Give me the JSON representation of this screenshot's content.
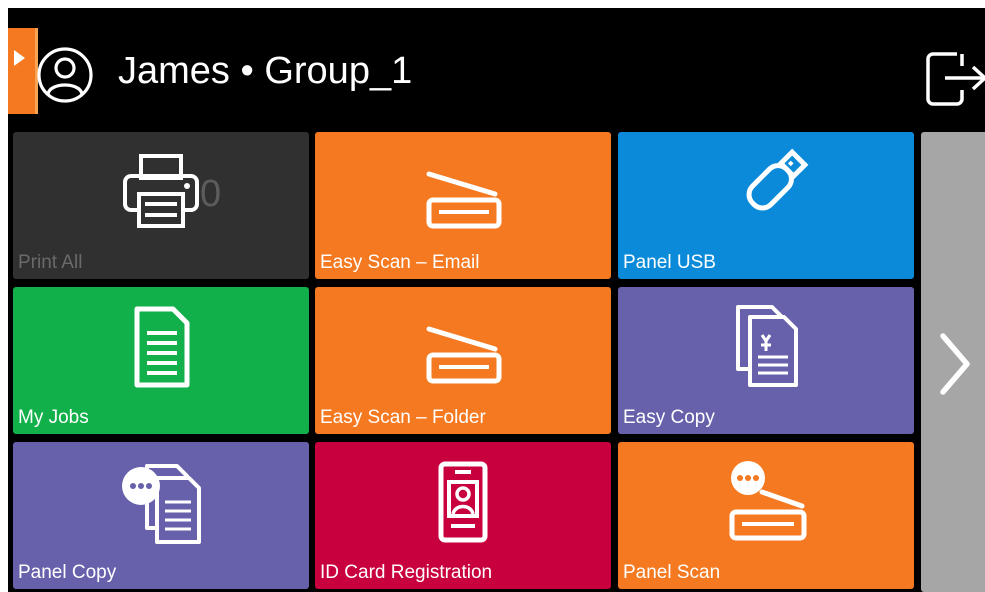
{
  "header": {
    "user_title": "James • Group_1",
    "side_tab_icon": "play-arrow-icon",
    "avatar_icon": "user-avatar-icon",
    "logout_icon": "logout-icon"
  },
  "tiles": [
    {
      "label": "Print All",
      "counter": "0",
      "color": "#303030",
      "label_color": "#6a6a6a",
      "icon": "printer-icon"
    },
    {
      "label": "Easy Scan – Email",
      "color": "#f47920",
      "icon": "scanner-icon"
    },
    {
      "label": "Panel USB",
      "color": "#0a8ad8",
      "icon": "usb-drive-icon"
    },
    {
      "label": "My Jobs",
      "color": "#12b04a",
      "icon": "document-icon"
    },
    {
      "label": "Easy Scan – Folder",
      "color": "#f47920",
      "icon": "scanner-icon"
    },
    {
      "label": "Easy Copy",
      "color": "#6761ac",
      "icon": "copy-documents-icon"
    },
    {
      "label": "Panel Copy",
      "color": "#6761ac",
      "icon": "panel-copy-icon"
    },
    {
      "label": "ID Card Registration",
      "color": "#c8003e",
      "icon": "id-card-icon"
    },
    {
      "label": "Panel Scan",
      "color": "#f47920",
      "icon": "panel-scan-icon"
    }
  ],
  "next_panel": {
    "icon": "chevron-right-icon",
    "color": "#a6a6a6"
  }
}
